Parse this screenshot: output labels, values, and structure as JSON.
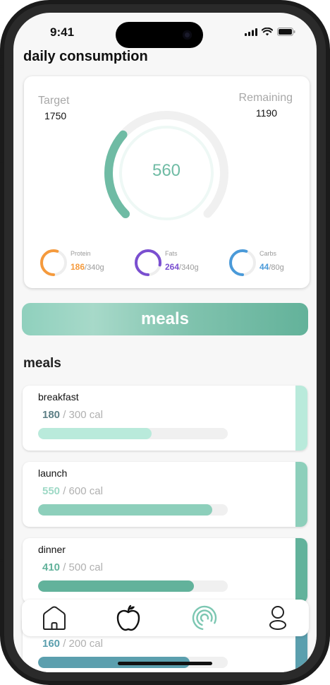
{
  "status": {
    "time": "9:41"
  },
  "page": {
    "title": "daily consumption"
  },
  "summary": {
    "target_label": "Target",
    "target_value": "1750",
    "remaining_label": "Remaining",
    "remaining_value": "1190",
    "consumed_value": "560",
    "consumed_fraction": 0.32,
    "gauge_color": "#6fbba4"
  },
  "macros": [
    {
      "name": "Protein",
      "value": "186",
      "total": "/340g",
      "fraction": 0.55,
      "color": "#f59a3c"
    },
    {
      "name": "Fats",
      "value": "264",
      "total": "/340g",
      "fraction": 0.78,
      "color": "#7a4fd0"
    },
    {
      "name": "Carbs",
      "value": "44",
      "total": "/80g",
      "fraction": 0.55,
      "color": "#4a9ad9"
    }
  ],
  "banner": {
    "label": "meals"
  },
  "meals_section": {
    "title": "meals"
  },
  "meals": [
    {
      "name": "breakfast",
      "value": "180",
      "total": " / 300 cal",
      "fraction": 0.6,
      "color": "#b9eadb",
      "value_color": "#5d7f86"
    },
    {
      "name": "launch",
      "value": "550",
      "total": " / 600 cal",
      "fraction": 0.917,
      "color": "#8dcfbb",
      "value_color": "#9ed9c6"
    },
    {
      "name": "dinner",
      "value": "410",
      "total": " / 500 cal",
      "fraction": 0.82,
      "color": "#62b29b",
      "value_color": "#62b29b"
    },
    {
      "name": "",
      "value": "160",
      "total": " / 200 cal",
      "fraction": 0.8,
      "color": "#5b9fae",
      "value_color": "#5b9fae"
    }
  ],
  "tabbar": {
    "items": [
      {
        "icon": "home-icon"
      },
      {
        "icon": "apple-icon"
      },
      {
        "icon": "progress-rings-icon"
      },
      {
        "icon": "profile-icon"
      }
    ]
  }
}
